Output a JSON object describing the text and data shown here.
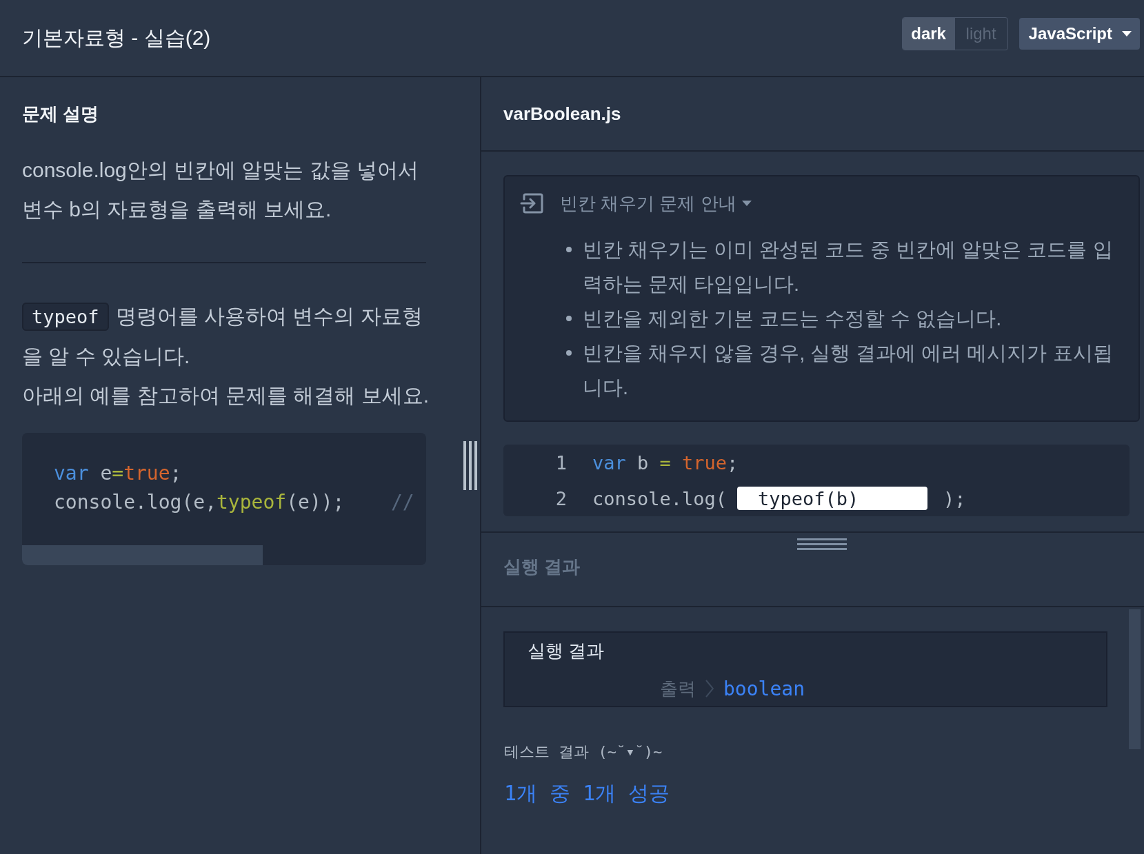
{
  "header": {
    "title": "기본자료형 - 실습(2)",
    "theme_toggle": [
      {
        "label": "dark",
        "selected": true
      },
      {
        "label": "light",
        "selected": false
      }
    ],
    "language_dropdown": {
      "value": "JavaScript"
    }
  },
  "problem": {
    "heading": "문제 설명",
    "intro": "console.log안의 빈칸에 알맞는 값을 넣어서 변수 b의 자료형을 출력해 보세요.",
    "usage": {
      "code": "typeof",
      "text": "명령어를 사용하여 변수의 자료형을 알 수 있습니다."
    },
    "instruction": "아래의 예를 참고하여 문제를 해결해 보세요.",
    "example_code": [
      [
        {
          "kind": "keyword",
          "text": "var"
        },
        {
          "kind": "plain",
          "text": " e"
        },
        {
          "kind": "operator",
          "text": "="
        },
        {
          "kind": "literal",
          "text": "true"
        },
        {
          "kind": "plain",
          "text": ";"
        }
      ],
      [
        {
          "kind": "plain",
          "text": "console.log(e,"
        },
        {
          "kind": "builtin",
          "text": "typeof"
        },
        {
          "kind": "plain",
          "text": "(e));"
        },
        {
          "kind": "comment",
          "text": "//"
        }
      ]
    ]
  },
  "editor": {
    "file_name": "varBoolean.js",
    "guide": {
      "title": "빈칸 채우기 문제 안내",
      "expanded": true,
      "items": [
        "빈칸 채우기는 이미 완성된 코드 중 빈칸에 알맞은 코드를 입력하는 문제 타입입니다.",
        "빈칸을 제외한 기본 코드는 수정할 수 없습니다.",
        "빈칸을 채우지 않을 경우, 실행 결과에 에러 메시지가 표시됩니다."
      ]
    },
    "lines": [
      {
        "number": "1",
        "tokens": [
          {
            "kind": "keyword",
            "text": "var"
          },
          {
            "kind": "plain",
            "text": " b "
          },
          {
            "kind": "operator",
            "text": "="
          },
          {
            "kind": "literal",
            "text": " true"
          },
          {
            "kind": "plain",
            "text": ";"
          }
        ]
      },
      {
        "number": "2",
        "tokens": [
          {
            "kind": "plain",
            "text": "console.log("
          },
          {
            "kind": "blank",
            "value": "typeof(b)"
          },
          {
            "kind": "plain",
            "text": ");"
          }
        ]
      }
    ]
  },
  "result": {
    "title": "실행 결과",
    "output": {
      "title": "실행 결과",
      "label": "출력",
      "value": "boolean"
    },
    "test_title": "테스트 결과 (~˘▾˘)~",
    "test_summary": "1개 중 1개 성공"
  }
}
